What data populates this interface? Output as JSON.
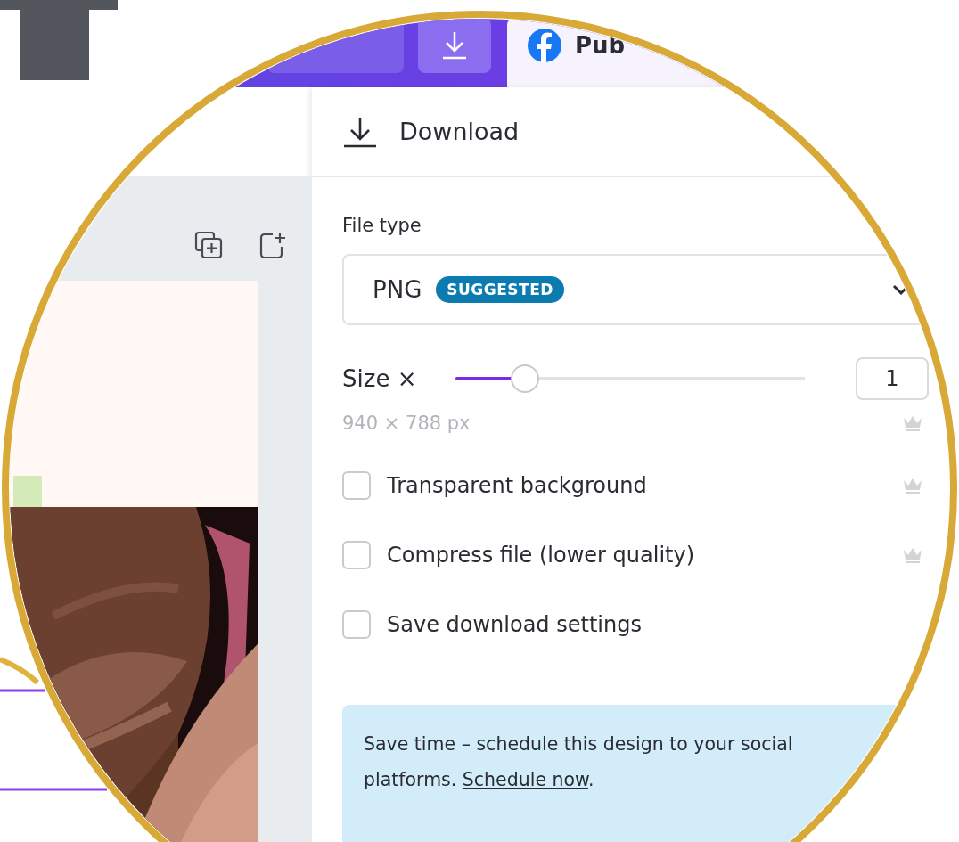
{
  "top_bar": {
    "publish_tab": {
      "label": "Pub",
      "selected": true
    }
  },
  "panel": {
    "title": "Download",
    "file_type_label": "File type",
    "file_type": {
      "value": "PNG",
      "badge": "SUGGESTED"
    },
    "size": {
      "label": "Size ×",
      "level": 0.2,
      "value": "1"
    },
    "dimensions": {
      "text": "940 × 788 px",
      "premium": true
    },
    "options": [
      {
        "label": "Transparent background",
        "checked": false,
        "premium": true
      },
      {
        "label": "Compress file (lower quality)",
        "checked": false,
        "premium": true
      },
      {
        "label": "Save download settings",
        "checked": false,
        "premium": false
      }
    ],
    "info": {
      "text": "Save time – schedule this design to your social platforms. ",
      "link": "Schedule now",
      "end": "."
    }
  }
}
